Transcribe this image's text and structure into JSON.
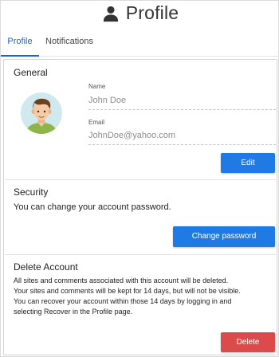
{
  "header": {
    "title": "Profile",
    "icon": "person-icon"
  },
  "tabs": [
    {
      "label": "Profile",
      "active": true
    },
    {
      "label": "Notifications",
      "active": false
    }
  ],
  "colors": {
    "accent": "#1e63d6",
    "primary_button": "#1f7ae3",
    "danger_button": "#db4b4b"
  },
  "general": {
    "title": "General",
    "name_label": "Name",
    "name_value": "John Doe",
    "email_label": "Email",
    "email_value": "JohnDoe@yahoo.com",
    "edit_label": "Edit"
  },
  "security": {
    "title": "Security",
    "text": "You can change your account password.",
    "button_label": "Change password"
  },
  "delete_account": {
    "title": "Delete Account",
    "lines": [
      "All sites and comments associated with this account will be deleted.",
      "Your sites and comments will be kept for 14 days, but will not be visible.",
      "You can recover your account within those 14 days by logging in and",
      "selecting Recover in the Profile page."
    ],
    "button_label": "Delete"
  }
}
